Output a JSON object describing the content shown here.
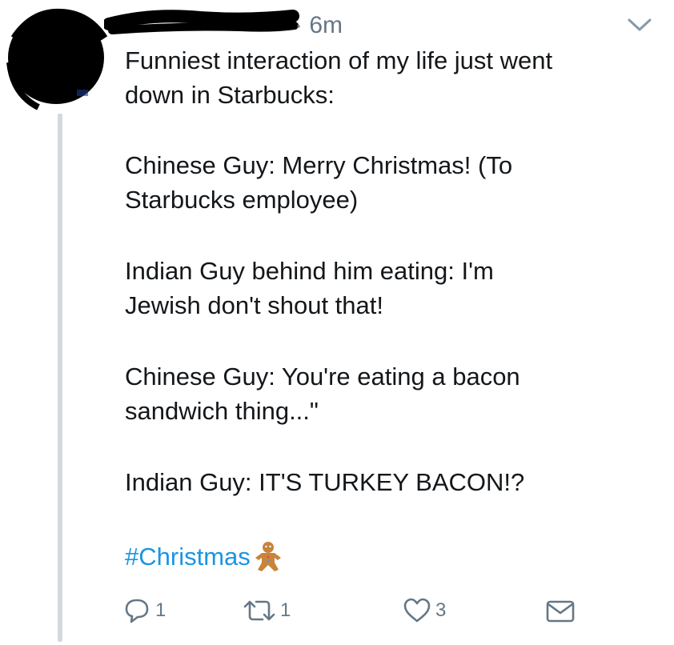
{
  "tweet": {
    "timestamp": "· 6m",
    "paragraphs": [
      "Funniest interaction of my life just went\ndown in Starbucks:",
      "Chinese Guy: Merry Christmas! (To\nStarbucks employee)",
      "Indian Guy behind him eating: I'm\nJewish don't shout that!",
      "Chinese Guy: You're eating a bacon\nsandwich thing...\"",
      "Indian Guy: IT'S TURKEY BACON!?"
    ],
    "hashtag": "#Christmas",
    "hashtag_emoji": "gingerbread-man-icon"
  },
  "actions": {
    "reply_count": "1",
    "retweet_count": "1",
    "like_count": "3"
  },
  "colors": {
    "text": "#14171a",
    "muted": "#657786",
    "link": "#1b95e0",
    "thread": "#d2d9df",
    "redaction": "#000000"
  }
}
